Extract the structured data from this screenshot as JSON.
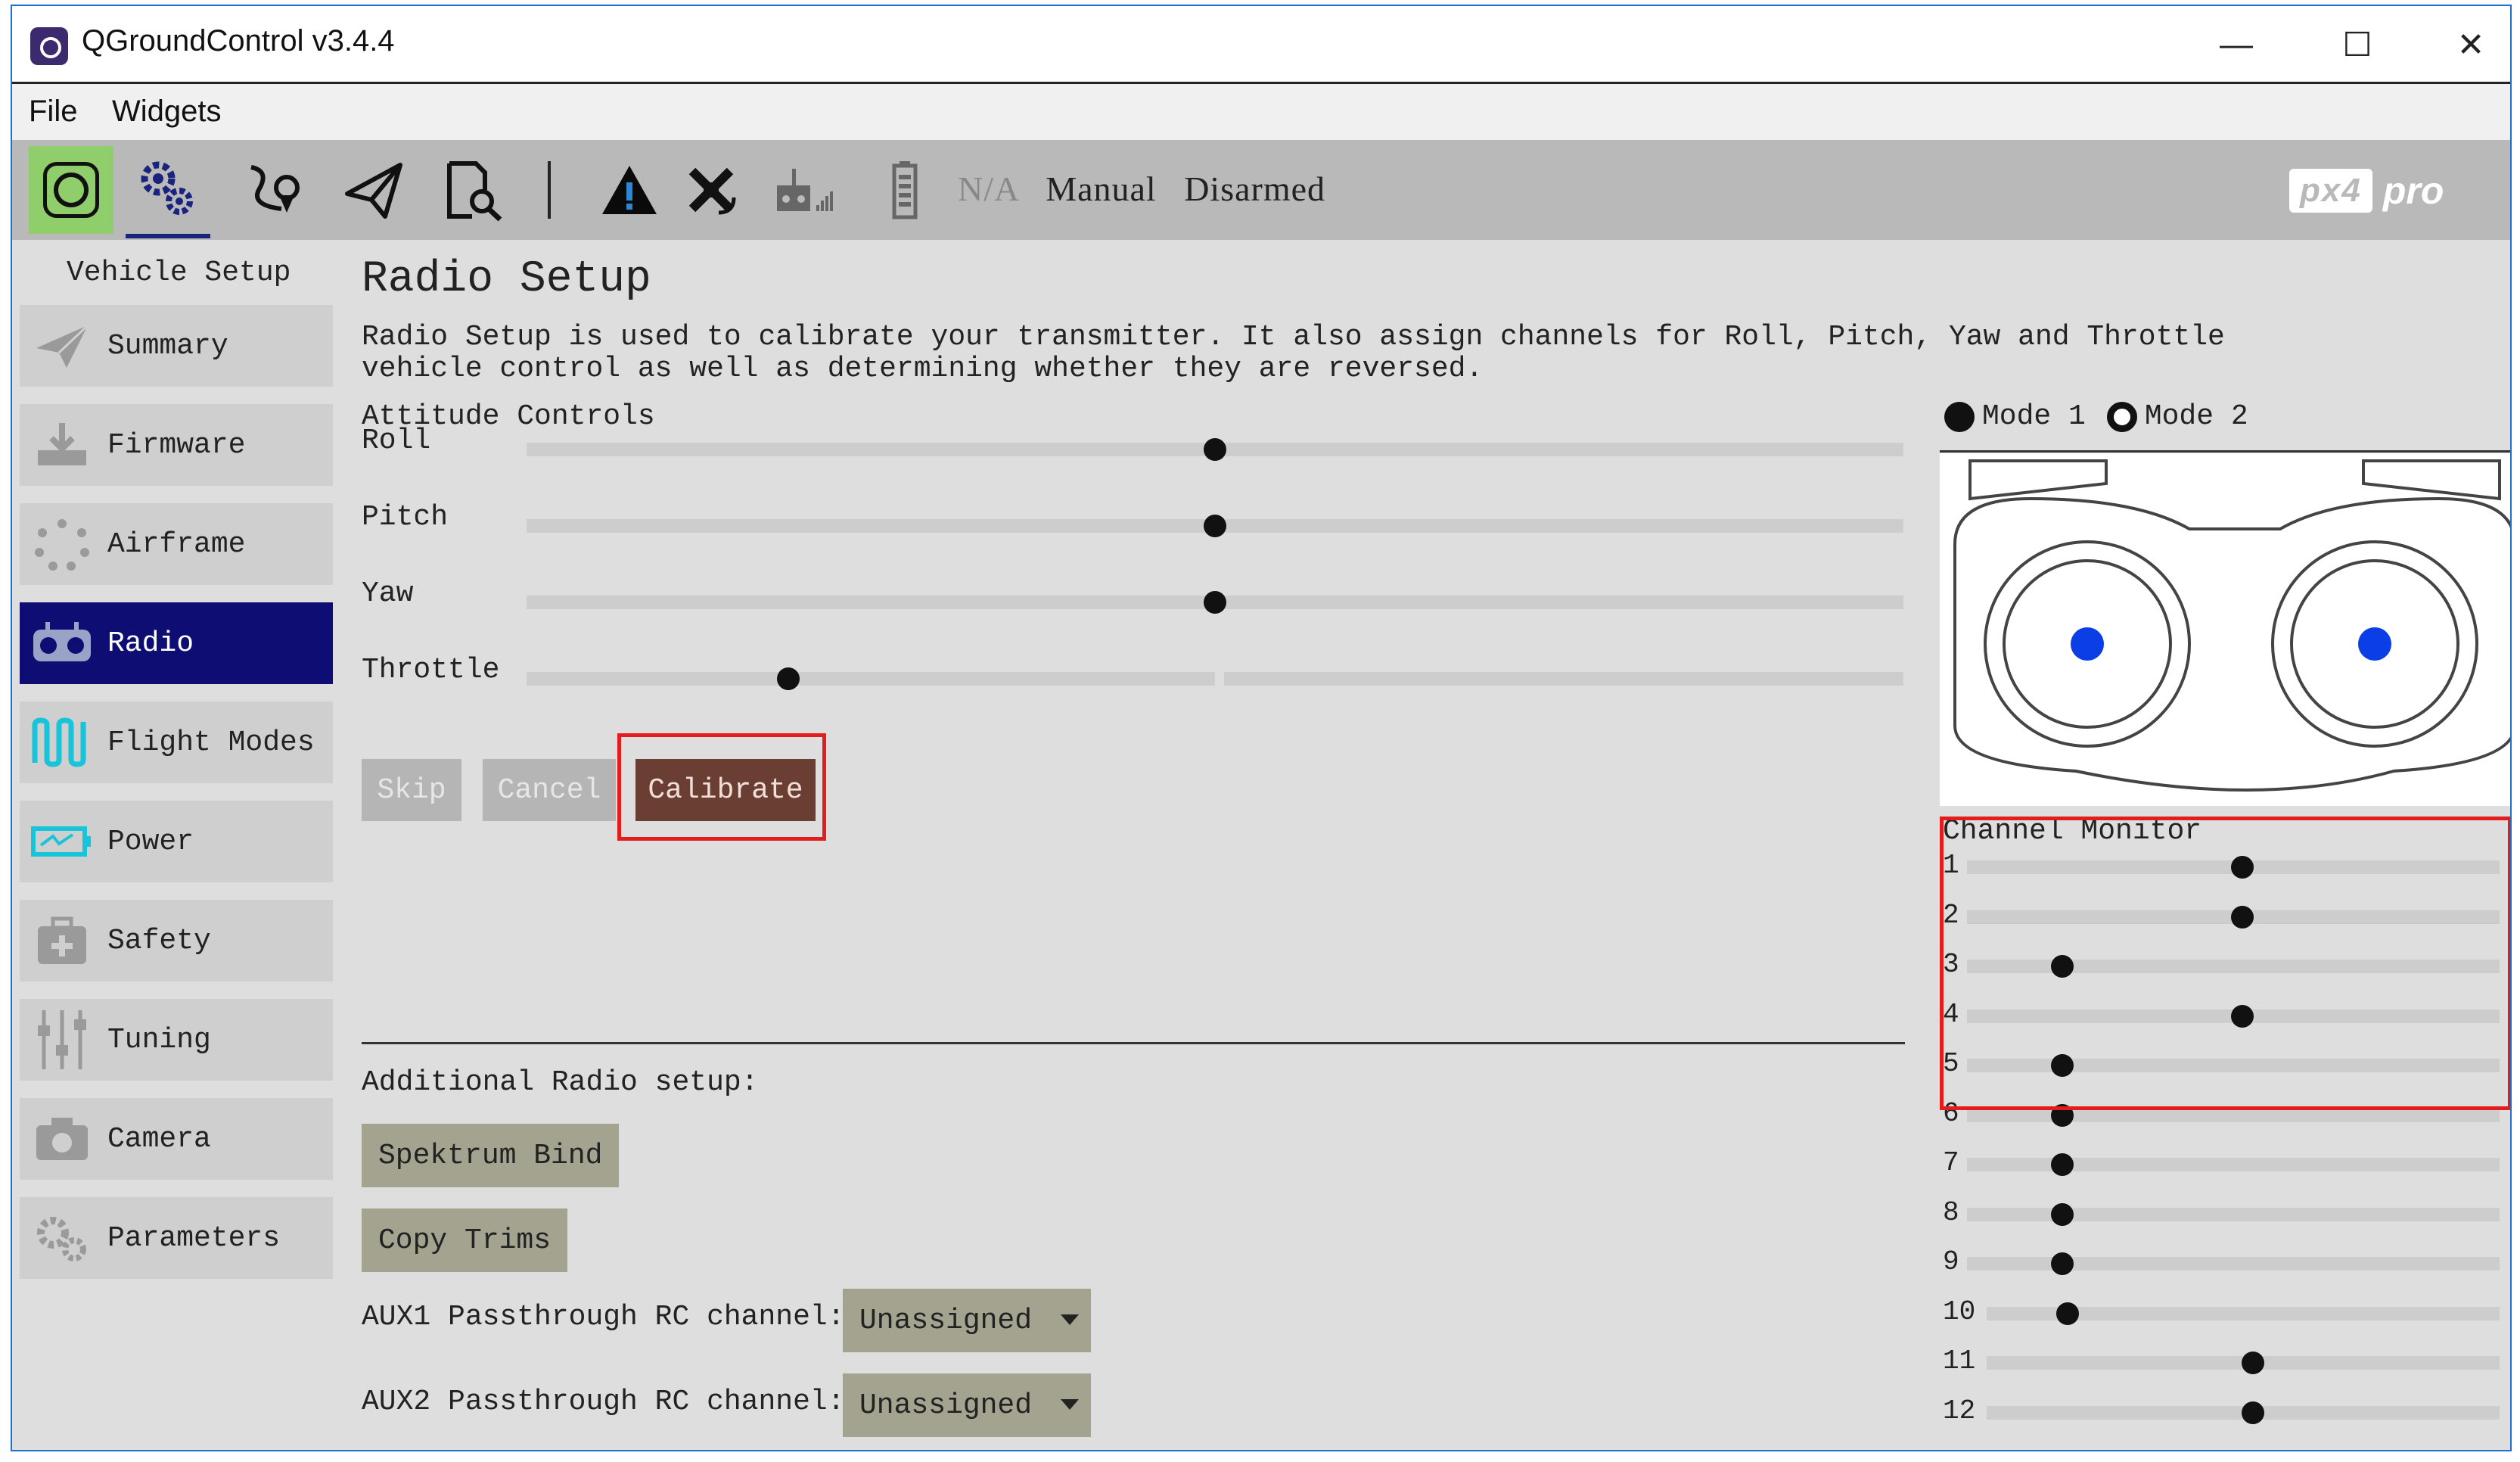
{
  "window": {
    "title": "QGroundControl v3.4.4",
    "minimize_glyph": "—",
    "maximize_glyph": "☐",
    "close_glyph": "✕"
  },
  "menu": {
    "items": [
      "File",
      "Widgets"
    ]
  },
  "toolbar": {
    "battery_text": "N/A",
    "flight_mode": "Manual",
    "arm_state": "Disarmed",
    "brand_logo": "px4",
    "brand_suffix": "pro"
  },
  "sidebar": {
    "title": "Vehicle Setup",
    "items": [
      {
        "label": "Summary",
        "icon": "paper-plane-icon"
      },
      {
        "label": "Firmware",
        "icon": "download-icon"
      },
      {
        "label": "Airframe",
        "icon": "airframe-icon"
      },
      {
        "label": "Radio",
        "icon": "radio-icon",
        "active": true
      },
      {
        "label": "Flight Modes",
        "icon": "flight-modes-icon"
      },
      {
        "label": "Power",
        "icon": "battery-icon"
      },
      {
        "label": "Safety",
        "icon": "safety-icon"
      },
      {
        "label": "Tuning",
        "icon": "tuning-icon"
      },
      {
        "label": "Camera",
        "icon": "camera-icon"
      },
      {
        "label": "Parameters",
        "icon": "gears-icon"
      }
    ]
  },
  "main": {
    "title": "Radio Setup",
    "description": "Radio Setup is used to calibrate your transmitter. It also assign channels for Roll, Pitch, Yaw and Throttle vehicle control as well as determining whether they are reversed.",
    "attitude_title": "Attitude Controls",
    "attitude": [
      {
        "label": "Roll",
        "value": 0.5
      },
      {
        "label": "Pitch",
        "value": 0.5
      },
      {
        "label": "Yaw",
        "value": 0.5
      },
      {
        "label": "Throttle",
        "value": 0.19
      }
    ],
    "buttons": {
      "skip": "Skip",
      "cancel": "Cancel",
      "calibrate": "Calibrate"
    },
    "additional_title": "Additional Radio setup:",
    "spektrum_bind": "Spektrum Bind",
    "copy_trims": "Copy Trims",
    "aux": [
      {
        "label": "AUX1 Passthrough RC channel:",
        "value": "Unassigned"
      },
      {
        "label": "AUX2 Passthrough RC channel:",
        "value": "Unassigned"
      }
    ]
  },
  "right": {
    "mode1": "Mode 1",
    "mode2": "Mode 2",
    "channel_monitor_title": "Channel Monitor",
    "channels": [
      {
        "n": "1",
        "value": 0.52
      },
      {
        "n": "2",
        "value": 0.52
      },
      {
        "n": "3",
        "value": 0.18
      },
      {
        "n": "4",
        "value": 0.52
      },
      {
        "n": "5",
        "value": 0.18
      },
      {
        "n": "6",
        "value": 0.18
      },
      {
        "n": "7",
        "value": 0.18
      },
      {
        "n": "8",
        "value": 0.18
      },
      {
        "n": "9",
        "value": 0.18
      },
      {
        "n": "10",
        "value": 0.19
      },
      {
        "n": "11",
        "value": 0.54
      },
      {
        "n": "12",
        "value": 0.54
      }
    ]
  },
  "colors": {
    "active_nav": "#0d0d73",
    "calibrate": "#6b3e33",
    "highlight": "#e41c1c",
    "stick_dot": "#0b3ee6",
    "home_button": "#8fce6a"
  }
}
